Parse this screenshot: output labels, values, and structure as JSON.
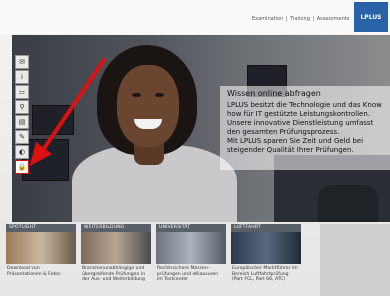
{
  "header": {
    "nav": [
      "Examination",
      "Training",
      "Assessments"
    ],
    "separator": "|",
    "logo_text": "LPLUS"
  },
  "sidebar": {
    "icons": [
      {
        "name": "mail-icon",
        "glyph": "✉"
      },
      {
        "name": "info-icon",
        "glyph": "i"
      },
      {
        "name": "sitemap-icon",
        "glyph": "⚏"
      },
      {
        "name": "search-icon",
        "glyph": "⚲"
      },
      {
        "name": "print-icon",
        "glyph": "▤"
      },
      {
        "name": "tools-icon",
        "glyph": "✎"
      },
      {
        "name": "globe-icon",
        "glyph": "◐"
      },
      {
        "name": "lock-icon",
        "glyph": "🔒",
        "active": true
      }
    ]
  },
  "hero": {
    "title": "Wissen online abfragen",
    "lines": [
      "LPLUS besitzt die Technologie und das Know",
      "how für IT gestützte Leistungskontrollen.",
      "Unsere innovative Dienstleistung umfasst",
      "den gesamten Prüfungsprozess.",
      "Mit LPLUS sparen Sie Zeit und Geld bei",
      "steigender Qualität Ihrer  Prüfungen."
    ]
  },
  "tiles": [
    {
      "header": "SPOTLIGHT",
      "caption": "Download von Präsentationen & Fotos"
    },
    {
      "header": "WEITERBILDUNG",
      "caption": "Branchenunabhängige und übergreifende Prüfungen in der Aus- und Weiterbildung"
    },
    {
      "header": "UNIVERSITÄT",
      "caption": "Rechtssichere Massen-prüfungen und eKlausuren im Testcenter"
    },
    {
      "header": "LUFTFAHRT",
      "caption": "Europäischer Marktführer im Bereich Luftfahrtprüfung (Part FCL, Part 66, ATC)"
    }
  ],
  "colors": {
    "arrow": "#dd1111",
    "logo": "#2a62a8",
    "tile_header": "#5a6068"
  }
}
